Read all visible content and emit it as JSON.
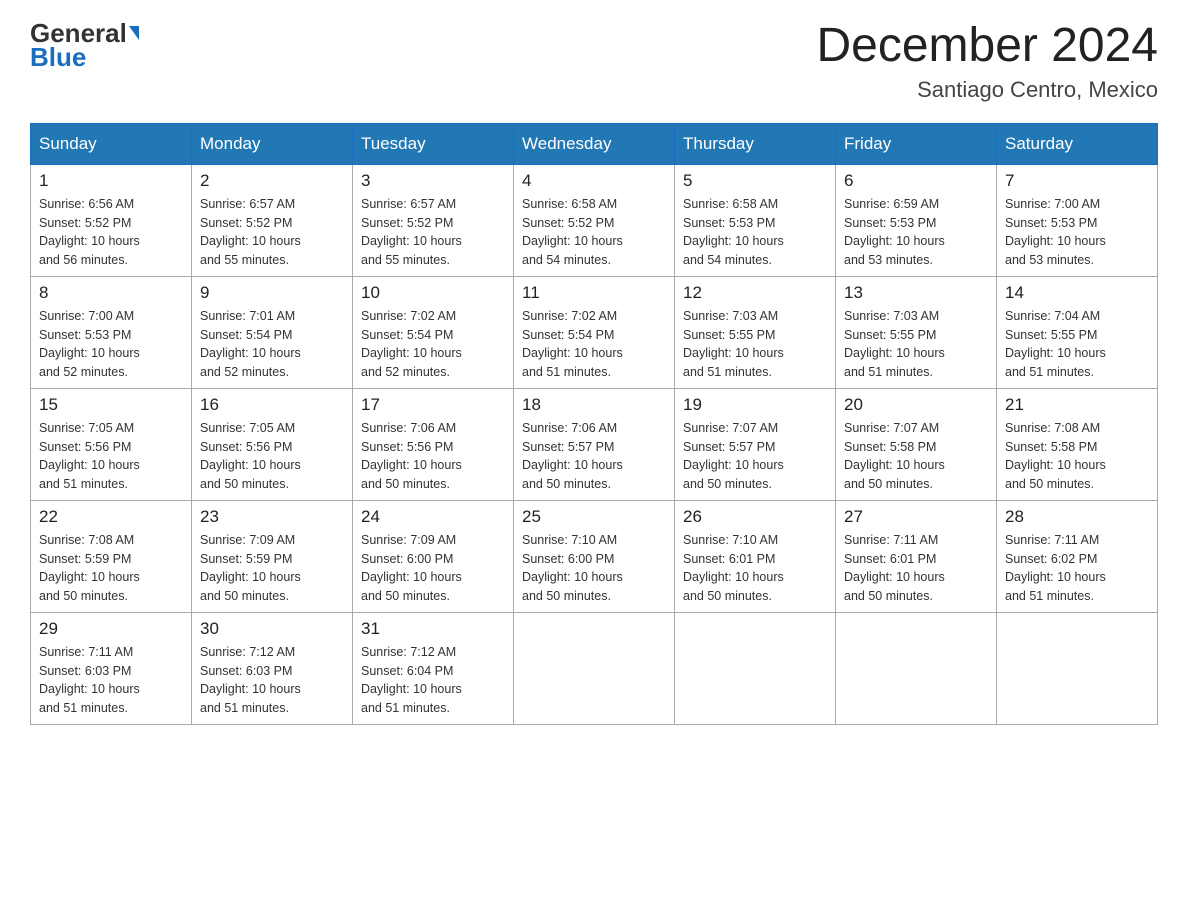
{
  "header": {
    "logo_general": "General",
    "logo_blue": "Blue",
    "month_title": "December 2024",
    "location": "Santiago Centro, Mexico"
  },
  "days_of_week": [
    "Sunday",
    "Monday",
    "Tuesday",
    "Wednesday",
    "Thursday",
    "Friday",
    "Saturday"
  ],
  "weeks": [
    [
      {
        "day": "1",
        "sunrise": "6:56 AM",
        "sunset": "5:52 PM",
        "daylight": "10 hours and 56 minutes."
      },
      {
        "day": "2",
        "sunrise": "6:57 AM",
        "sunset": "5:52 PM",
        "daylight": "10 hours and 55 minutes."
      },
      {
        "day": "3",
        "sunrise": "6:57 AM",
        "sunset": "5:52 PM",
        "daylight": "10 hours and 55 minutes."
      },
      {
        "day": "4",
        "sunrise": "6:58 AM",
        "sunset": "5:52 PM",
        "daylight": "10 hours and 54 minutes."
      },
      {
        "day": "5",
        "sunrise": "6:58 AM",
        "sunset": "5:53 PM",
        "daylight": "10 hours and 54 minutes."
      },
      {
        "day": "6",
        "sunrise": "6:59 AM",
        "sunset": "5:53 PM",
        "daylight": "10 hours and 53 minutes."
      },
      {
        "day": "7",
        "sunrise": "7:00 AM",
        "sunset": "5:53 PM",
        "daylight": "10 hours and 53 minutes."
      }
    ],
    [
      {
        "day": "8",
        "sunrise": "7:00 AM",
        "sunset": "5:53 PM",
        "daylight": "10 hours and 52 minutes."
      },
      {
        "day": "9",
        "sunrise": "7:01 AM",
        "sunset": "5:54 PM",
        "daylight": "10 hours and 52 minutes."
      },
      {
        "day": "10",
        "sunrise": "7:02 AM",
        "sunset": "5:54 PM",
        "daylight": "10 hours and 52 minutes."
      },
      {
        "day": "11",
        "sunrise": "7:02 AM",
        "sunset": "5:54 PM",
        "daylight": "10 hours and 51 minutes."
      },
      {
        "day": "12",
        "sunrise": "7:03 AM",
        "sunset": "5:55 PM",
        "daylight": "10 hours and 51 minutes."
      },
      {
        "day": "13",
        "sunrise": "7:03 AM",
        "sunset": "5:55 PM",
        "daylight": "10 hours and 51 minutes."
      },
      {
        "day": "14",
        "sunrise": "7:04 AM",
        "sunset": "5:55 PM",
        "daylight": "10 hours and 51 minutes."
      }
    ],
    [
      {
        "day": "15",
        "sunrise": "7:05 AM",
        "sunset": "5:56 PM",
        "daylight": "10 hours and 51 minutes."
      },
      {
        "day": "16",
        "sunrise": "7:05 AM",
        "sunset": "5:56 PM",
        "daylight": "10 hours and 50 minutes."
      },
      {
        "day": "17",
        "sunrise": "7:06 AM",
        "sunset": "5:56 PM",
        "daylight": "10 hours and 50 minutes."
      },
      {
        "day": "18",
        "sunrise": "7:06 AM",
        "sunset": "5:57 PM",
        "daylight": "10 hours and 50 minutes."
      },
      {
        "day": "19",
        "sunrise": "7:07 AM",
        "sunset": "5:57 PM",
        "daylight": "10 hours and 50 minutes."
      },
      {
        "day": "20",
        "sunrise": "7:07 AM",
        "sunset": "5:58 PM",
        "daylight": "10 hours and 50 minutes."
      },
      {
        "day": "21",
        "sunrise": "7:08 AM",
        "sunset": "5:58 PM",
        "daylight": "10 hours and 50 minutes."
      }
    ],
    [
      {
        "day": "22",
        "sunrise": "7:08 AM",
        "sunset": "5:59 PM",
        "daylight": "10 hours and 50 minutes."
      },
      {
        "day": "23",
        "sunrise": "7:09 AM",
        "sunset": "5:59 PM",
        "daylight": "10 hours and 50 minutes."
      },
      {
        "day": "24",
        "sunrise": "7:09 AM",
        "sunset": "6:00 PM",
        "daylight": "10 hours and 50 minutes."
      },
      {
        "day": "25",
        "sunrise": "7:10 AM",
        "sunset": "6:00 PM",
        "daylight": "10 hours and 50 minutes."
      },
      {
        "day": "26",
        "sunrise": "7:10 AM",
        "sunset": "6:01 PM",
        "daylight": "10 hours and 50 minutes."
      },
      {
        "day": "27",
        "sunrise": "7:11 AM",
        "sunset": "6:01 PM",
        "daylight": "10 hours and 50 minutes."
      },
      {
        "day": "28",
        "sunrise": "7:11 AM",
        "sunset": "6:02 PM",
        "daylight": "10 hours and 51 minutes."
      }
    ],
    [
      {
        "day": "29",
        "sunrise": "7:11 AM",
        "sunset": "6:03 PM",
        "daylight": "10 hours and 51 minutes."
      },
      {
        "day": "30",
        "sunrise": "7:12 AM",
        "sunset": "6:03 PM",
        "daylight": "10 hours and 51 minutes."
      },
      {
        "day": "31",
        "sunrise": "7:12 AM",
        "sunset": "6:04 PM",
        "daylight": "10 hours and 51 minutes."
      },
      null,
      null,
      null,
      null
    ]
  ],
  "labels": {
    "sunrise": "Sunrise:",
    "sunset": "Sunset:",
    "daylight": "Daylight:"
  }
}
